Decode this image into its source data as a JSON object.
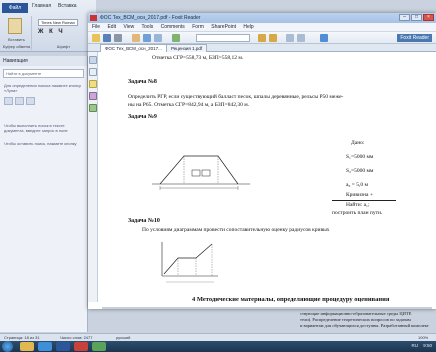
{
  "word": {
    "tabs": [
      "Файл",
      "Главная",
      "Вставка"
    ],
    "font_name": "Times New Roman",
    "format_buttons": "Ж К Ч",
    "paste_label": "Вставить",
    "clipboard_group": "Буфер обмена",
    "font_group": "Шрифт",
    "nav_title": "Навигация",
    "nav_search_placeholder": "Найти в документе",
    "nav_hint": "Для определения поиска нажмите кнопку «Лупа»",
    "nav_text_1": "Чтобы выполнить поиск в тексте документа, введите запрос в поле",
    "nav_text_2": "Чтобы оставить поиск, нажмите кнопку",
    "status_page": "Страница: 18 из 31",
    "status_words": "Число слов: 2477",
    "status_lang": "русский",
    "zoom": "100%"
  },
  "reader": {
    "title": "ФОС Тех_ВСМ_осн_2017.pdf - Foxit Reader",
    "menu": [
      "File",
      "Edit",
      "View",
      "Tools",
      "Comments",
      "Form",
      "SharePoint",
      "Help"
    ],
    "tabs": [
      "ФОС Тех_ВСМ_осн_2017...",
      "Рецензия 1.pdf"
    ],
    "right_label": "Foxit Reader"
  },
  "document": {
    "line_top": "Отметка СГР=558,73 м, БЗП=558,12 м.",
    "task8_title": "Задача №8",
    "task8_text1": "Определить РГР, если существующий балласт песок, шпалы деревянные, рельсы Р50 меже-",
    "task8_text2": "ны на Р65. Отметка СГР=842,94 м, а БЗП=842,30 м.",
    "task9_title": "Задача №9",
    "given_title": "Дано:",
    "given_lines": [
      "S₁=5000 мм",
      "S₂=5000 мм",
      "a₀ = 5,0 м",
      "Кривизна +"
    ],
    "find_title": "Найти: a₁;",
    "find_text": "построить план пути.",
    "task10_title": "Задача №10",
    "task10_text": "По условиям диаграммам провести сопоставительную оценку радиусов кривых",
    "section_title": "4 Методические материалы, определяющие процедуру оценивания",
    "right_text_1": "ствующие информационно-образовательные среды ЦИТЕ",
    "right_text_2": "тели). Распределение теоретических вопросов по задачам",
    "right_text_3": "и вариантам для обучающихся доступны. Разработанный комплект"
  },
  "taskbar": {
    "time": "9:50",
    "lang": "RU"
  }
}
